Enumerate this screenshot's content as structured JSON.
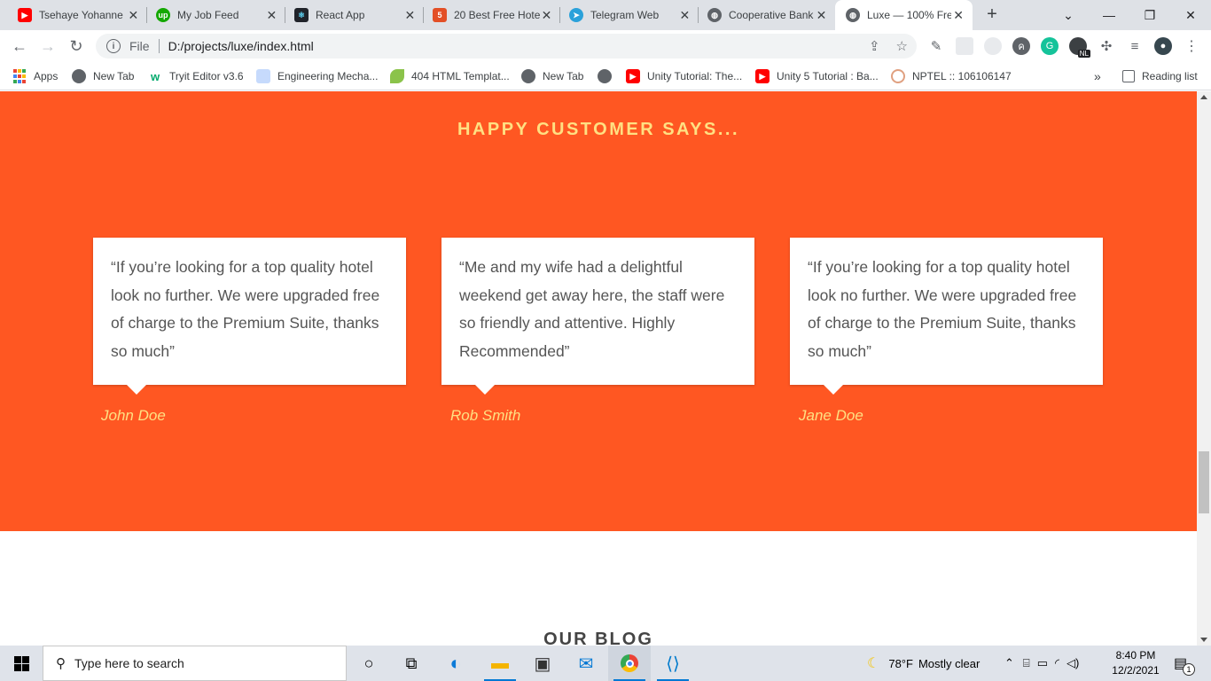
{
  "browser": {
    "tabs": [
      {
        "title": "Tsehaye Yohanne",
        "icon": "youtube-icon",
        "color": "#ff0000"
      },
      {
        "title": "My Job Feed",
        "icon": "upwork-icon",
        "color": "#14a800"
      },
      {
        "title": "React App",
        "icon": "react-icon",
        "color": "#20232a"
      },
      {
        "title": "20 Best Free Hote",
        "icon": "html5-icon",
        "color": "#e34f26"
      },
      {
        "title": "Telegram Web",
        "icon": "telegram-icon",
        "color": "#2aa1da"
      },
      {
        "title": "Cooperative Bank",
        "icon": "globe-icon",
        "color": "#5f6368"
      },
      {
        "title": "Luxe — 100% Fre",
        "icon": "globe-icon",
        "color": "#5f6368",
        "active": true
      }
    ],
    "address": {
      "scheme": "File",
      "url": "D:/projects/luxe/index.html"
    },
    "bookmarks": [
      {
        "label": "Apps"
      },
      {
        "label": "New Tab"
      },
      {
        "label": "Tryit Editor v3.6"
      },
      {
        "label": "Engineering Mecha..."
      },
      {
        "label": "404 HTML Templat..."
      },
      {
        "label": "New Tab"
      },
      {
        "label": ""
      },
      {
        "label": "Unity Tutorial: The..."
      },
      {
        "label": "Unity 5 Tutorial : Ba..."
      },
      {
        "label": "NPTEL :: 106106147"
      }
    ],
    "bookmarks_overflow": "»",
    "reading_list": "Reading list",
    "extension_badge": "NL"
  },
  "page": {
    "section_title": "HAPPY CUSTOMER SAYS...",
    "testimonials": [
      {
        "quote": "“If you’re looking for a top quality hotel look no further. We were upgraded free of charge to the Premium Suite, thanks so much”",
        "author": "John Doe"
      },
      {
        "quote": "“Me and my wife had a delightful weekend get away here, the staff were so friendly and attentive. Highly Recommended”",
        "author": "Rob Smith"
      },
      {
        "quote": "“If you’re looking for a top quality hotel look no further. We were upgraded free of charge to the Premium Suite, thanks so much”",
        "author": "Jane Doe"
      }
    ],
    "blog_title": "OUR BLOG",
    "colors": {
      "accent": "#ff5722",
      "title": "#ffe082"
    }
  },
  "taskbar": {
    "search_placeholder": "Type here to search",
    "weather": {
      "temp": "78°F",
      "condition": "Mostly clear"
    },
    "time": "8:40 PM",
    "date": "12/2/2021",
    "notification_count": "1"
  }
}
